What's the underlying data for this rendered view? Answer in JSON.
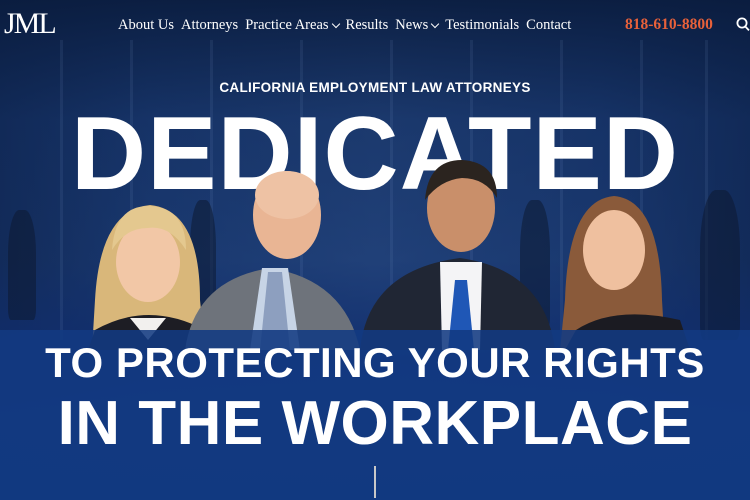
{
  "header": {
    "logo_text": "JML",
    "nav": [
      {
        "label": "About Us",
        "dropdown": false
      },
      {
        "label": "Attorneys",
        "dropdown": false
      },
      {
        "label": "Practice Areas",
        "dropdown": true
      },
      {
        "label": "Results",
        "dropdown": false
      },
      {
        "label": "News",
        "dropdown": true
      },
      {
        "label": "Testimonials",
        "dropdown": false
      },
      {
        "label": "Contact",
        "dropdown": false
      }
    ],
    "phone": "818-610-8800",
    "search_icon": "search-icon"
  },
  "hero": {
    "eyebrow": "CALIFORNIA EMPLOYMENT LAW ATTORNEYS",
    "headline": "DEDICATED",
    "tagline_line1": "TO PROTECTING YOUR RIGHTS",
    "tagline_line2": "IN THE WORKPLACE"
  },
  "colors": {
    "accent_phone": "#e8613a",
    "background": "#0f2a5c",
    "text": "#ffffff"
  }
}
